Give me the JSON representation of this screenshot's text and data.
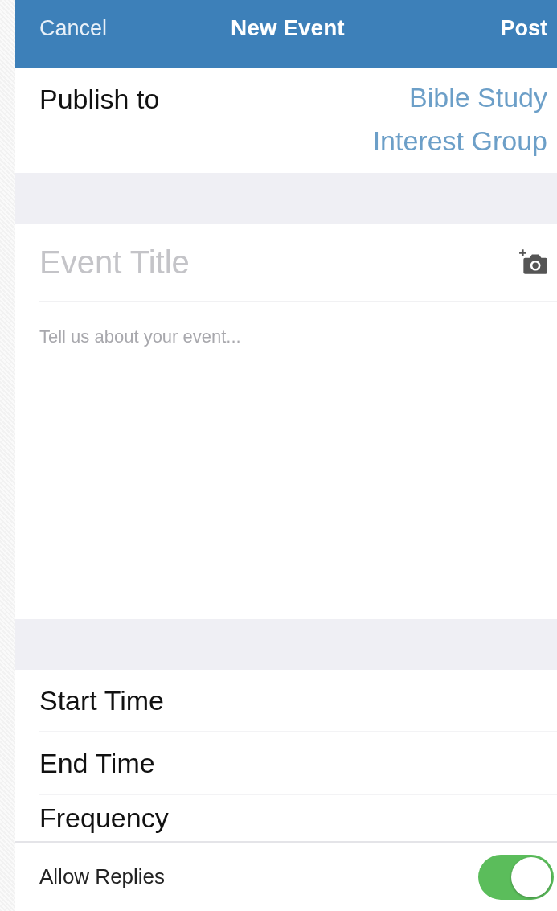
{
  "nav_bar": {
    "cancel": "Cancel",
    "title": "New Event",
    "post": "Post"
  },
  "publish_to": {
    "label": "Publish to",
    "value": "Bible Study Interest Group"
  },
  "event_title": {
    "placeholder": "Event Title"
  },
  "description": {
    "placeholder": "Tell us about your event..."
  },
  "settings": [
    {
      "label": "Start Time"
    },
    {
      "label": "End Time"
    },
    {
      "label": "Frequency"
    }
  ],
  "allow_replies": {
    "label": "Allow Replies",
    "on": true
  }
}
